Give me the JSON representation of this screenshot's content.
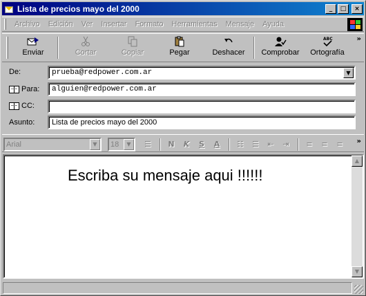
{
  "window": {
    "title": "Lista de precios mayo del 2000",
    "controls": {
      "minimize": "_",
      "maximize": "□",
      "close": "×"
    }
  },
  "menu": {
    "items": [
      "Archivo",
      "Edición",
      "Ver",
      "Insertar",
      "Formato",
      "Herramientas",
      "Mensaje",
      "Ayuda"
    ]
  },
  "toolbar": {
    "send": {
      "label": "Enviar",
      "icon": "send-icon",
      "enabled": true
    },
    "cut": {
      "label": "Cortar",
      "icon": "scissors-icon",
      "enabled": false
    },
    "copy": {
      "label": "Copiar",
      "icon": "copy-icon",
      "enabled": false
    },
    "paste": {
      "label": "Pegar",
      "icon": "paste-icon",
      "enabled": true
    },
    "undo": {
      "label": "Deshacer",
      "icon": "undo-icon",
      "enabled": true
    },
    "check": {
      "label": "Comprobar",
      "icon": "check-names-icon",
      "enabled": true
    },
    "spelling": {
      "label": "Ortografía",
      "icon": "spelling-icon",
      "enabled": true
    },
    "more": "»"
  },
  "header": {
    "from_label": "De:",
    "from_value": "prueba@redpower.com.ar",
    "to_label": "Para:",
    "to_value": "alguien@redpower.com.ar",
    "cc_label": "CC:",
    "cc_value": "",
    "subject_label": "Asunto:",
    "subject_value": "Lista de precios mayo del 2000"
  },
  "format": {
    "font": "Arial",
    "size": "18",
    "more": "»"
  },
  "body": {
    "text": "Escriba su mensaje aqui !!!!!!"
  },
  "colors": {
    "title_start": "#000080",
    "title_end": "#1084d0",
    "chrome": "#c0c0c0"
  }
}
